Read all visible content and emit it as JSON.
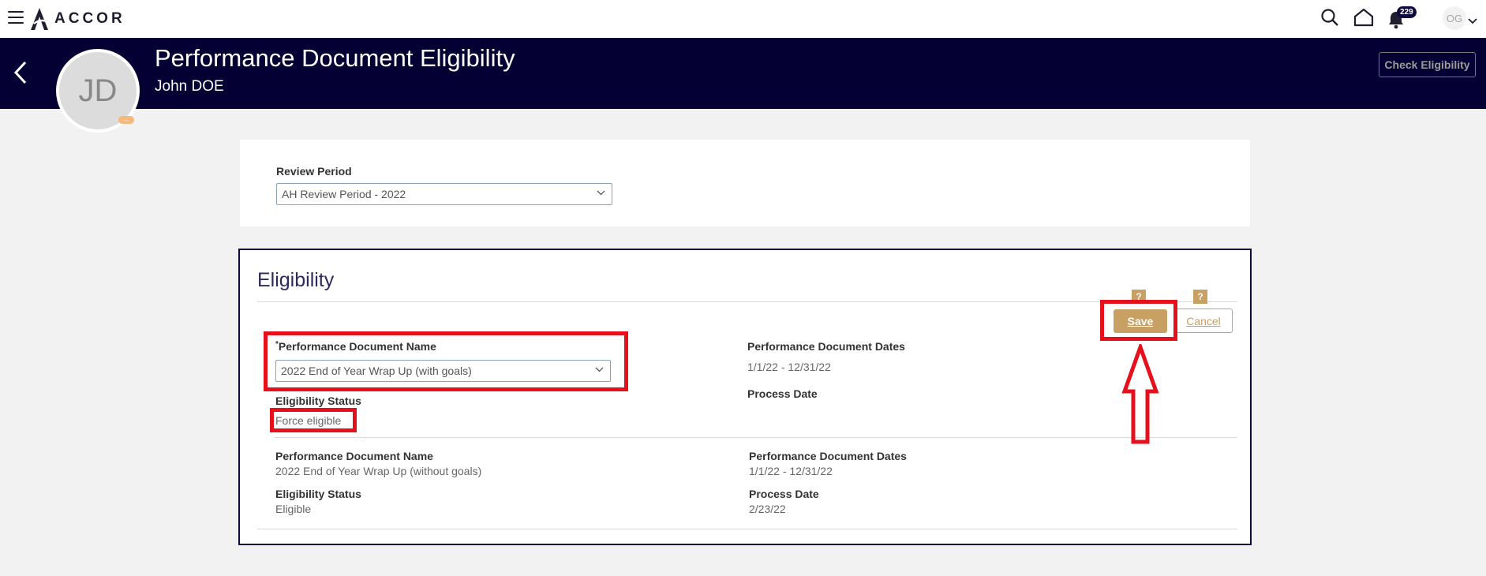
{
  "topbar": {
    "logo_text": "ACCOR",
    "notification_count": "229",
    "user_initials": "OG"
  },
  "header": {
    "title": "Performance Document Eligibility",
    "subtitle": "John DOE",
    "avatar_initials": "JD",
    "avatar_badge": "...",
    "check_eligibility_label": "Check Eligibility"
  },
  "review_period": {
    "label": "Review Period",
    "selected": "AH Review Period - 2022"
  },
  "eligibility": {
    "title": "Eligibility",
    "help_label": "?",
    "save_label": "Save",
    "cancel_label": "Cancel",
    "current": {
      "required_mark": "*",
      "doc_name_label": "Performance Document Name",
      "doc_name_selected": "2022 End of Year Wrap Up (with goals)",
      "status_label": "Eligibility Status",
      "status_value": "Force eligible",
      "dates_label": "Performance Document Dates",
      "dates_value": "1/1/22 - 12/31/22",
      "process_label": "Process Date",
      "process_value": ""
    },
    "previous": {
      "doc_name_label": "Performance Document Name",
      "doc_name_value": "2022 End of Year Wrap Up (without goals)",
      "status_label": "Eligibility Status",
      "status_value": "Eligible",
      "dates_label": "Performance Document Dates",
      "dates_value": "1/1/22 - 12/31/22",
      "process_label": "Process Date",
      "process_value": "2/23/22"
    }
  },
  "colors": {
    "header_bg": "#050033",
    "accent_gold": "#c9a063",
    "annotation_red": "#e5101b"
  }
}
